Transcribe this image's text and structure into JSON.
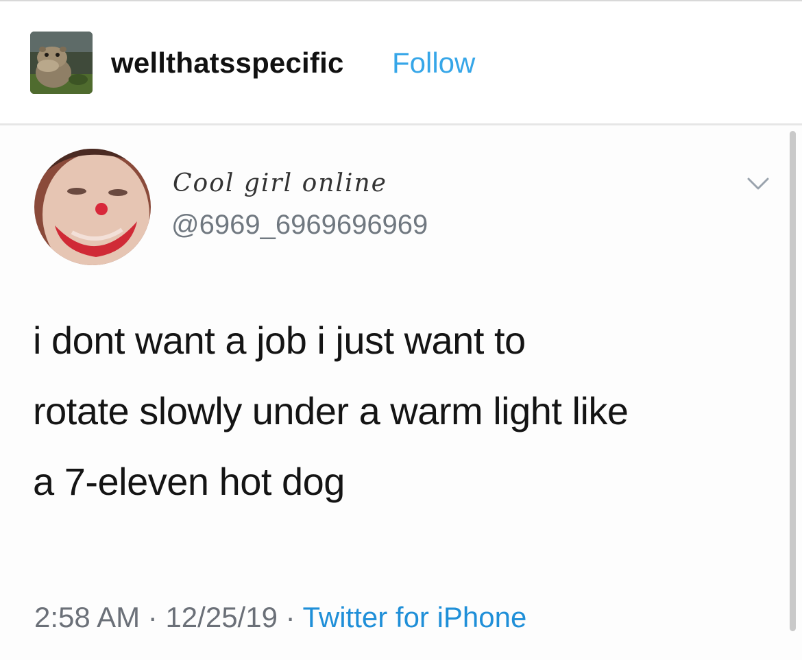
{
  "post": {
    "blog_name": "wellthatsspecific",
    "follow_label": "Follow",
    "blog_avatar_icon": "hippo-avatar-icon",
    "accent_color": "#36a6e8"
  },
  "tweet": {
    "display_name": "Cool girl online",
    "handle": "@6969_6969696969",
    "avatar_icon": "clown-face-avatar-icon",
    "menu_icon": "chevron-down-icon",
    "text_lines": [
      "i dont want a job i just want to",
      "rotate slowly under a warm light like",
      "a 7-eleven hot dog"
    ],
    "time": "2:58 AM",
    "separator": "·",
    "date": "12/25/19",
    "source": "Twitter for iPhone",
    "link_color": "#1f8fd8"
  }
}
